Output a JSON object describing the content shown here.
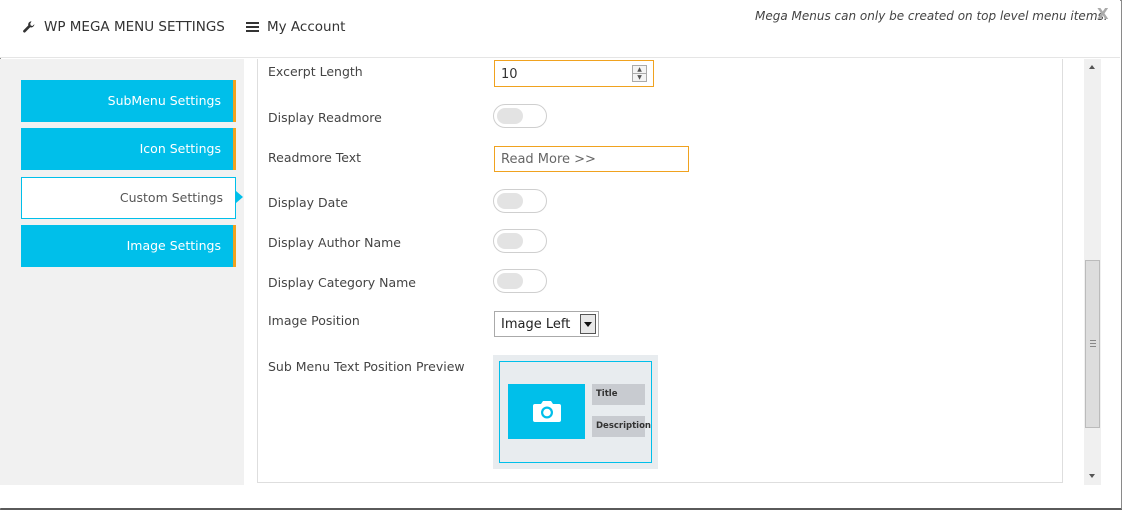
{
  "header": {
    "settings_label": "WP MEGA MENU SETTINGS",
    "settings_icon": "wrench-icon",
    "account_label": "My Account",
    "account_icon": "hamburger-icon",
    "notice": "Mega Menus can only be created on top level menu items.",
    "close_label": "X"
  },
  "sidebar": {
    "items": [
      {
        "label": "SubMenu Settings",
        "active": false
      },
      {
        "label": "Icon Settings",
        "active": false
      },
      {
        "label": "Custom Settings",
        "active": true
      },
      {
        "label": "Image Settings",
        "active": false
      }
    ]
  },
  "form": {
    "excerpt_length": {
      "label": "Excerpt Length",
      "value": "10"
    },
    "display_readmore": {
      "label": "Display Readmore",
      "on": false
    },
    "readmore_text": {
      "label": "Readmore Text",
      "value": "Read More >>"
    },
    "display_date": {
      "label": "Display Date",
      "on": false
    },
    "display_author": {
      "label": "Display Author Name",
      "on": false
    },
    "display_category": {
      "label": "Display Category Name",
      "on": false
    },
    "image_position": {
      "label": "Image Position",
      "value": "Image Left"
    },
    "preview": {
      "label": "Sub Menu Text Position Preview",
      "title_tag": "Title",
      "description_tag": "Description",
      "image_icon": "camera-icon"
    }
  },
  "colors": {
    "accent": "#00bfea",
    "highlight": "#f0a21f"
  }
}
